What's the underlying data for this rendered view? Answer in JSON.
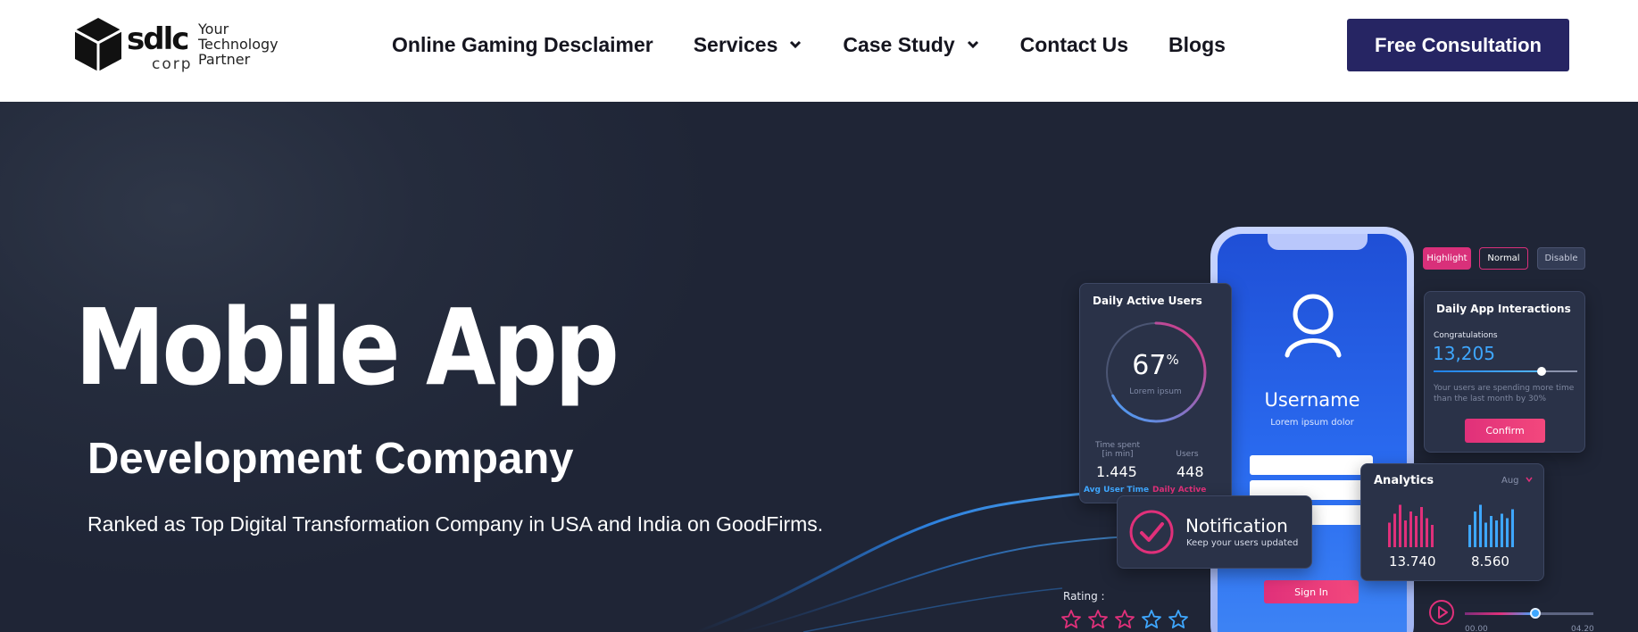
{
  "brand": {
    "logo_word": "sdlc",
    "logo_sub": "corp",
    "tagline": [
      "Your",
      "Technology",
      "Partner"
    ]
  },
  "nav": {
    "items": [
      {
        "label": "Online Gaming Desclaimer",
        "has_dropdown": false
      },
      {
        "label": "Services",
        "has_dropdown": true
      },
      {
        "label": "Case Study",
        "has_dropdown": true
      },
      {
        "label": "Contact Us",
        "has_dropdown": false
      },
      {
        "label": "Blogs",
        "has_dropdown": false
      }
    ],
    "cta": "Free Consultation"
  },
  "hero": {
    "title": "Mobile App",
    "subtitle": "Development Company",
    "description": "Ranked as Top Digital Transformation Company in USA and India on GoodFirms."
  },
  "illustration": {
    "daily_active_users": {
      "title": "Daily Active Users",
      "percent": "67",
      "percent_symbol": "%",
      "percent_value": 0.67,
      "lorem": "Lorem ipsum",
      "time_label": [
        "Time spent",
        "[in min]"
      ],
      "time_value": "1.445",
      "users_label": "Users",
      "users_value": "448",
      "foot_left": "Avg User Time",
      "foot_right": "Daily Active users"
    },
    "phone": {
      "username": "Username",
      "lorem": "Lorem ipsum dolor",
      "signin": "Sign In"
    },
    "pills": {
      "highlight": "Highlight",
      "normal": "Normal",
      "disable": "Disable"
    },
    "app_interactions": {
      "title": "Daily App Interactions",
      "congrats": "Congratulations",
      "value": "13,205",
      "slider_level": 0.75,
      "description": "Your users are spending more time than the last month by 30%",
      "confirm": "Confirm"
    },
    "analytics": {
      "title": "Analytics",
      "month": "Aug",
      "value_left": "13.740",
      "value_right": "8.560",
      "bars_left": [
        0.55,
        0.75,
        0.95,
        0.6,
        0.8,
        0.7,
        0.9,
        0.65,
        0.5
      ],
      "bars_right": [
        0.5,
        0.8,
        0.95,
        0.55,
        0.7,
        0.6,
        0.75,
        0.65,
        0.85
      ]
    },
    "notification": {
      "title": "Notification",
      "subtitle": "Keep your users updated"
    },
    "rating": {
      "label": "Rating :",
      "stars": 5
    },
    "player": {
      "time_start": "00.00",
      "time_end": "04.20",
      "progress": 0.55
    }
  },
  "colors": {
    "cta_bg": "#262563",
    "accent_pink": "#e0307a",
    "accent_blue": "#3ea7ff",
    "hero_bg": "#252c3d"
  }
}
